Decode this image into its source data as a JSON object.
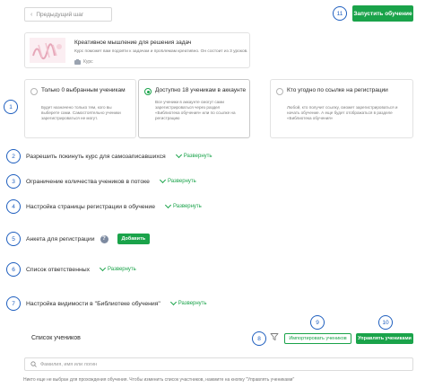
{
  "toolbar": {
    "prev_label": "Предыдущий шаг",
    "launch_label": "Запустить обучение",
    "accent_color": "#1aa34a",
    "badge_color": "#1f5fbf"
  },
  "course": {
    "title": "Креативное мышление для решения задач",
    "description": "Курс поможет вам подойти к задачам и проблемам креативно. Он состоит из 3 уроков.",
    "type": "Курс"
  },
  "access_options": [
    {
      "title": "Только 0 выбранным ученикам",
      "description": "Будет назначено только тем, кого вы выберете сами. Самостоятельно ученики зарегистрироваться не могут.",
      "selected": false
    },
    {
      "title": "Доступно 18 ученикам в аккаунте",
      "description": "Все ученики в аккаунте смогут сами зарегистрироваться через раздел «Библиотека обучения» или по ссылке на регистрацию",
      "selected": true
    },
    {
      "title": "Кто угодно по ссылке на регистрации",
      "description": "Любой, кто получит ссылку, сможет зарегистрироваться и начать обучение. А еще будет отображаться в разделе «Библиотека обучения»",
      "selected": false
    }
  ],
  "expand_label": "Развернуть",
  "sections": [
    {
      "badge": "2",
      "label": "Разрешить покинуть курс для самозаписавшихся"
    },
    {
      "badge": "3",
      "label": "Ограничение количества учеников в потоке"
    },
    {
      "badge": "4",
      "label": "Настройка страницы регистрации в обучение"
    },
    {
      "badge": "5",
      "label": "Анкета для регистрации",
      "help": "?",
      "add_label": "Добавить"
    },
    {
      "badge": "6",
      "label": "Список ответственных"
    },
    {
      "badge": "7",
      "label": "Настройка видимости в \"Библиотеке обучения\""
    }
  ],
  "badges": {
    "b1": "1",
    "b8": "8",
    "b9": "9",
    "b10": "10",
    "b11": "11"
  },
  "students": {
    "title": "Список учеников",
    "import_label": "Импортировать учеников",
    "manage_label": "Управлять учениками",
    "search_placeholder": "Фамилия, имя или логин",
    "footer_note": "Никто еще не выбран для прохождения обучения. Чтобы изменить список участников, нажмите на кнопку \"Управлять учениками\""
  }
}
